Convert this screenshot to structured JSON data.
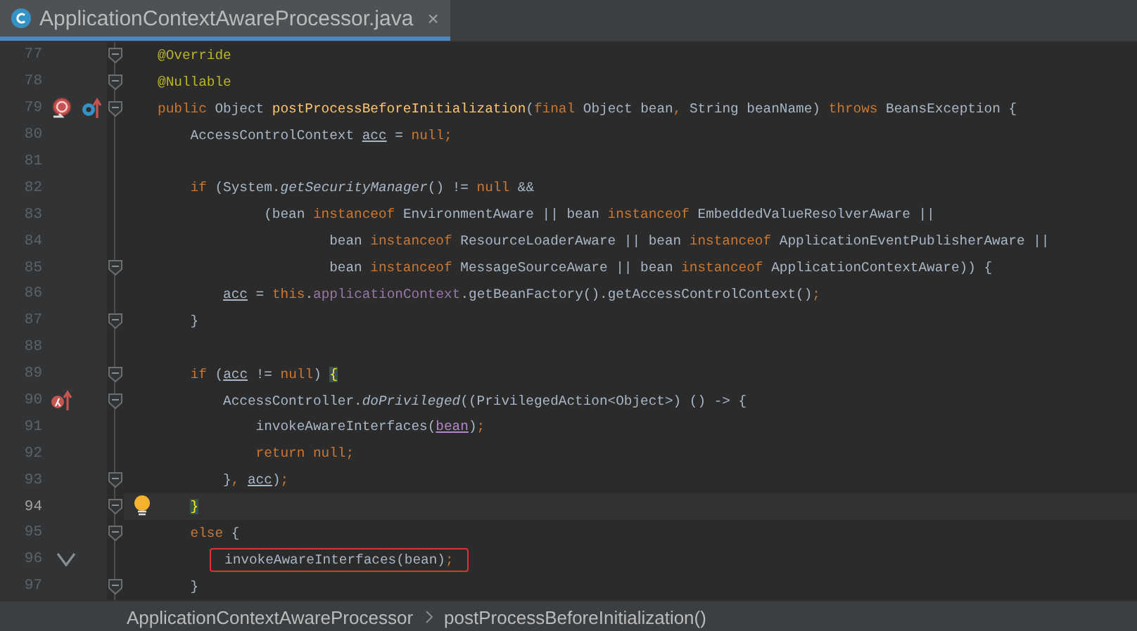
{
  "tab": {
    "title": "ApplicationContextAwareProcessor.java",
    "selected": true,
    "close": "×"
  },
  "lines": [
    {
      "number": "77",
      "fold": true,
      "tokens": [
        {
          "text": "@Override",
          "kind": "annotation"
        }
      ]
    },
    {
      "number": "78",
      "fold": true,
      "tokens": [
        {
          "text": "@Nullable",
          "kind": "annotation"
        }
      ]
    },
    {
      "number": "79",
      "fold": true,
      "gutter_icons": [
        {
          "kind": "overrides"
        },
        {
          "kind": "implements"
        }
      ],
      "tokens": [
        {
          "text": "public",
          "kind": "keyword"
        },
        {
          "text": " Object ",
          "kind": "plain"
        },
        {
          "text": "postProcessBeforeInitialization",
          "kind": "declaration"
        },
        {
          "text": "(",
          "kind": "plain"
        },
        {
          "text": "final",
          "kind": "keyword"
        },
        {
          "text": " Object bean",
          "kind": "plain"
        },
        {
          "text": ",",
          "kind": "punct"
        },
        {
          "text": " String beanName) ",
          "kind": "plain"
        },
        {
          "text": "throws",
          "kind": "keyword"
        },
        {
          "text": " BeansException {",
          "kind": "plain"
        }
      ]
    },
    {
      "number": "80",
      "fold": false,
      "tokens": [
        {
          "text": "    AccessControlContext ",
          "kind": "plain"
        },
        {
          "text": "acc",
          "kind": "variable"
        },
        {
          "text": " = ",
          "kind": "plain"
        },
        {
          "text": "null",
          "kind": "keyword"
        },
        {
          "text": ";",
          "kind": "punct"
        }
      ]
    },
    {
      "number": "81",
      "fold": false
    },
    {
      "number": "82",
      "fold": false,
      "tokens": [
        {
          "text": "    if",
          "kind": "keyword"
        },
        {
          "text": " (System.",
          "kind": "plain"
        },
        {
          "text": "getSecurityManager",
          "kind": "static"
        },
        {
          "text": "() != ",
          "kind": "plain"
        },
        {
          "text": "null",
          "kind": "keyword"
        },
        {
          "text": " &&",
          "kind": "plain"
        }
      ]
    },
    {
      "number": "83",
      "fold": false,
      "tokens": [
        {
          "text": "             (bean ",
          "kind": "plain"
        },
        {
          "text": "instanceof",
          "kind": "keyword"
        },
        {
          "text": " EnvironmentAware || bean ",
          "kind": "plain"
        },
        {
          "text": "instanceof",
          "kind": "keyword"
        },
        {
          "text": " EmbeddedValueResolverAware ||",
          "kind": "plain"
        }
      ]
    },
    {
      "number": "84",
      "fold": false,
      "tokens": [
        {
          "text": "                     bean ",
          "kind": "plain"
        },
        {
          "text": "instanceof",
          "kind": "keyword"
        },
        {
          "text": " ResourceLoaderAware || bean ",
          "kind": "plain"
        },
        {
          "text": "instanceof",
          "kind": "keyword"
        },
        {
          "text": " ApplicationEventPublisherAware ||",
          "kind": "plain"
        }
      ]
    },
    {
      "number": "85",
      "fold": true,
      "tokens": [
        {
          "text": "                     bean ",
          "kind": "plain"
        },
        {
          "text": "instanceof",
          "kind": "keyword"
        },
        {
          "text": " MessageSourceAware || bean ",
          "kind": "plain"
        },
        {
          "text": "instanceof",
          "kind": "keyword"
        },
        {
          "text": " ApplicationContextAware)) {",
          "kind": "plain"
        }
      ]
    },
    {
      "number": "86",
      "fold": false,
      "tokens": [
        {
          "text": "        acc",
          "kind": "variable"
        },
        {
          "text": " = ",
          "kind": "plain"
        },
        {
          "text": "this",
          "kind": "keyword"
        },
        {
          "text": ".",
          "kind": "plain"
        },
        {
          "text": "applicationContext",
          "kind": "field"
        },
        {
          "text": ".getBeanFactory().getAccessControlContext()",
          "kind": "plain"
        },
        {
          "text": ";",
          "kind": "punct"
        }
      ]
    },
    {
      "number": "87",
      "fold": true,
      "tokens": [
        {
          "text": "    }",
          "kind": "plain"
        }
      ]
    },
    {
      "number": "88",
      "fold": false
    },
    {
      "number": "89",
      "fold": true,
      "tokens": [
        {
          "text": "    if",
          "kind": "keyword"
        },
        {
          "text": " (",
          "kind": "plain"
        },
        {
          "text": "acc",
          "kind": "variable"
        },
        {
          "text": " != ",
          "kind": "plain"
        },
        {
          "text": "null",
          "kind": "keyword"
        },
        {
          "text": ") ",
          "kind": "plain"
        },
        {
          "text": "{",
          "kind": "brace"
        }
      ]
    },
    {
      "number": "90",
      "fold": true,
      "gutter_icons": [
        {
          "kind": "lambda"
        }
      ],
      "tokens": [
        {
          "text": "        AccessController.",
          "kind": "plain"
        },
        {
          "text": "doPrivileged",
          "kind": "static"
        },
        {
          "text": "((PrivilegedAction<Object>) () -> {",
          "kind": "plain"
        }
      ]
    },
    {
      "number": "91",
      "fold": false,
      "tokens": [
        {
          "text": "            invokeAwareInterfaces(",
          "kind": "plain"
        },
        {
          "text": "bean",
          "kind": "parameter"
        },
        {
          "text": ")",
          "kind": "plain"
        },
        {
          "text": ";",
          "kind": "punct"
        }
      ]
    },
    {
      "number": "92",
      "fold": false,
      "tokens": [
        {
          "text": "            return ",
          "kind": "keyword"
        },
        {
          "text": "null",
          "kind": "keyword"
        },
        {
          "text": ";",
          "kind": "punct"
        }
      ]
    },
    {
      "number": "93",
      "fold": true,
      "tokens": [
        {
          "text": "        }",
          "kind": "plain"
        },
        {
          "text": ", ",
          "kind": "punct"
        },
        {
          "text": "acc",
          "kind": "variable"
        },
        {
          "text": ")",
          "kind": "plain"
        },
        {
          "text": ";",
          "kind": "punct"
        }
      ]
    },
    {
      "number": "94",
      "fold": true,
      "current": true,
      "bulb": true,
      "tokens": [
        {
          "text": "    }",
          "kind": "brace"
        }
      ]
    },
    {
      "number": "95",
      "fold": true,
      "tokens": [
        {
          "text": "    else",
          "kind": "keyword"
        },
        {
          "text": " {",
          "kind": "plain"
        }
      ]
    },
    {
      "number": "96",
      "fold": false,
      "gutter_icons": [
        {
          "kind": "check"
        }
      ],
      "boxed": true,
      "tokens": [
        {
          "text": "        invokeAwareInterfaces(bean)",
          "kind": "plain"
        },
        {
          "text": ";",
          "kind": "punct"
        }
      ]
    },
    {
      "number": "97",
      "fold": true,
      "tokens": [
        {
          "text": "    }",
          "kind": "plain"
        }
      ]
    }
  ],
  "breadcrumbs": [
    "ApplicationContextAwareProcessor",
    "postProcessBeforeInitialization()"
  ]
}
